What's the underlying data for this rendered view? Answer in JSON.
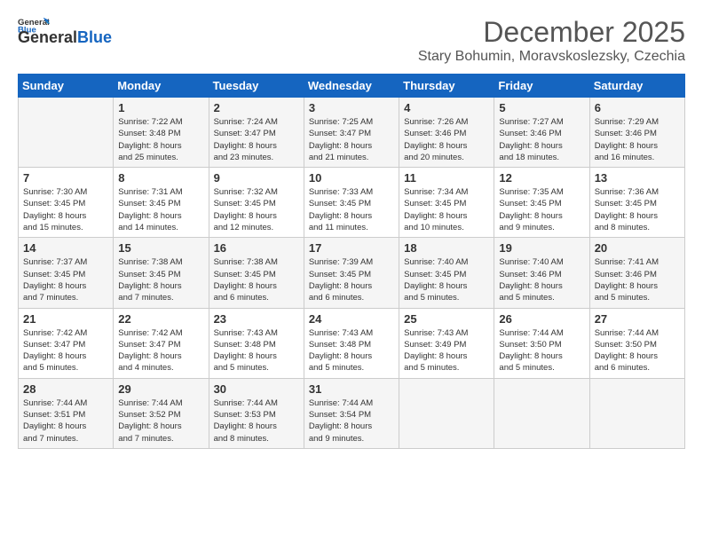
{
  "header": {
    "logo_general": "General",
    "logo_blue": "Blue",
    "month_title": "December 2025",
    "subtitle": "Stary Bohumin, Moravskoslezsky, Czechia"
  },
  "days_of_week": [
    "Sunday",
    "Monday",
    "Tuesday",
    "Wednesday",
    "Thursday",
    "Friday",
    "Saturday"
  ],
  "weeks": [
    [
      {
        "day": "",
        "info": ""
      },
      {
        "day": "1",
        "info": "Sunrise: 7:22 AM\nSunset: 3:48 PM\nDaylight: 8 hours\nand 25 minutes."
      },
      {
        "day": "2",
        "info": "Sunrise: 7:24 AM\nSunset: 3:47 PM\nDaylight: 8 hours\nand 23 minutes."
      },
      {
        "day": "3",
        "info": "Sunrise: 7:25 AM\nSunset: 3:47 PM\nDaylight: 8 hours\nand 21 minutes."
      },
      {
        "day": "4",
        "info": "Sunrise: 7:26 AM\nSunset: 3:46 PM\nDaylight: 8 hours\nand 20 minutes."
      },
      {
        "day": "5",
        "info": "Sunrise: 7:27 AM\nSunset: 3:46 PM\nDaylight: 8 hours\nand 18 minutes."
      },
      {
        "day": "6",
        "info": "Sunrise: 7:29 AM\nSunset: 3:46 PM\nDaylight: 8 hours\nand 16 minutes."
      }
    ],
    [
      {
        "day": "7",
        "info": "Sunrise: 7:30 AM\nSunset: 3:45 PM\nDaylight: 8 hours\nand 15 minutes."
      },
      {
        "day": "8",
        "info": "Sunrise: 7:31 AM\nSunset: 3:45 PM\nDaylight: 8 hours\nand 14 minutes."
      },
      {
        "day": "9",
        "info": "Sunrise: 7:32 AM\nSunset: 3:45 PM\nDaylight: 8 hours\nand 12 minutes."
      },
      {
        "day": "10",
        "info": "Sunrise: 7:33 AM\nSunset: 3:45 PM\nDaylight: 8 hours\nand 11 minutes."
      },
      {
        "day": "11",
        "info": "Sunrise: 7:34 AM\nSunset: 3:45 PM\nDaylight: 8 hours\nand 10 minutes."
      },
      {
        "day": "12",
        "info": "Sunrise: 7:35 AM\nSunset: 3:45 PM\nDaylight: 8 hours\nand 9 minutes."
      },
      {
        "day": "13",
        "info": "Sunrise: 7:36 AM\nSunset: 3:45 PM\nDaylight: 8 hours\nand 8 minutes."
      }
    ],
    [
      {
        "day": "14",
        "info": "Sunrise: 7:37 AM\nSunset: 3:45 PM\nDaylight: 8 hours\nand 7 minutes."
      },
      {
        "day": "15",
        "info": "Sunrise: 7:38 AM\nSunset: 3:45 PM\nDaylight: 8 hours\nand 7 minutes."
      },
      {
        "day": "16",
        "info": "Sunrise: 7:38 AM\nSunset: 3:45 PM\nDaylight: 8 hours\nand 6 minutes."
      },
      {
        "day": "17",
        "info": "Sunrise: 7:39 AM\nSunset: 3:45 PM\nDaylight: 8 hours\nand 6 minutes."
      },
      {
        "day": "18",
        "info": "Sunrise: 7:40 AM\nSunset: 3:45 PM\nDaylight: 8 hours\nand 5 minutes."
      },
      {
        "day": "19",
        "info": "Sunrise: 7:40 AM\nSunset: 3:46 PM\nDaylight: 8 hours\nand 5 minutes."
      },
      {
        "day": "20",
        "info": "Sunrise: 7:41 AM\nSunset: 3:46 PM\nDaylight: 8 hours\nand 5 minutes."
      }
    ],
    [
      {
        "day": "21",
        "info": "Sunrise: 7:42 AM\nSunset: 3:47 PM\nDaylight: 8 hours\nand 5 minutes."
      },
      {
        "day": "22",
        "info": "Sunrise: 7:42 AM\nSunset: 3:47 PM\nDaylight: 8 hours\nand 4 minutes."
      },
      {
        "day": "23",
        "info": "Sunrise: 7:43 AM\nSunset: 3:48 PM\nDaylight: 8 hours\nand 5 minutes."
      },
      {
        "day": "24",
        "info": "Sunrise: 7:43 AM\nSunset: 3:48 PM\nDaylight: 8 hours\nand 5 minutes."
      },
      {
        "day": "25",
        "info": "Sunrise: 7:43 AM\nSunset: 3:49 PM\nDaylight: 8 hours\nand 5 minutes."
      },
      {
        "day": "26",
        "info": "Sunrise: 7:44 AM\nSunset: 3:50 PM\nDaylight: 8 hours\nand 5 minutes."
      },
      {
        "day": "27",
        "info": "Sunrise: 7:44 AM\nSunset: 3:50 PM\nDaylight: 8 hours\nand 6 minutes."
      }
    ],
    [
      {
        "day": "28",
        "info": "Sunrise: 7:44 AM\nSunset: 3:51 PM\nDaylight: 8 hours\nand 7 minutes."
      },
      {
        "day": "29",
        "info": "Sunrise: 7:44 AM\nSunset: 3:52 PM\nDaylight: 8 hours\nand 7 minutes."
      },
      {
        "day": "30",
        "info": "Sunrise: 7:44 AM\nSunset: 3:53 PM\nDaylight: 8 hours\nand 8 minutes."
      },
      {
        "day": "31",
        "info": "Sunrise: 7:44 AM\nSunset: 3:54 PM\nDaylight: 8 hours\nand 9 minutes."
      },
      {
        "day": "",
        "info": ""
      },
      {
        "day": "",
        "info": ""
      },
      {
        "day": "",
        "info": ""
      }
    ]
  ]
}
